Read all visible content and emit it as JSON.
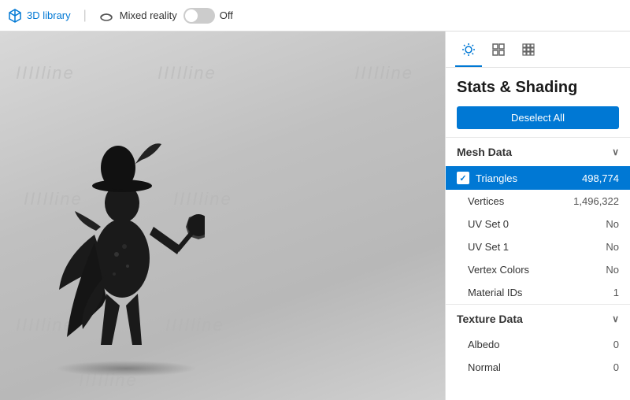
{
  "topbar": {
    "library_label": "3D library",
    "mixed_reality_label": "Mixed reality",
    "toggle_state": "Off"
  },
  "viewport": {
    "watermarks": [
      "IIIIline",
      "IIIIline",
      "IIIIline",
      "IIIIline",
      "IIIIline",
      "IIIIline",
      "IIIIline",
      "IIIIline"
    ]
  },
  "panel": {
    "title": "Stats & Shading",
    "deselect_btn": "Deselect All",
    "tabs": [
      {
        "id": "sun",
        "label": "Sun tab",
        "active": true
      },
      {
        "id": "grid",
        "label": "Grid tab",
        "active": false
      },
      {
        "id": "tiles",
        "label": "Tiles tab",
        "active": false
      }
    ],
    "sections": [
      {
        "id": "mesh-data",
        "label": "Mesh Data",
        "rows": [
          {
            "label": "Triangles",
            "value": "498,774",
            "highlighted": true,
            "checkbox": true,
            "indented": false
          },
          {
            "label": "Vertices",
            "value": "1,496,322",
            "highlighted": false,
            "checkbox": false,
            "indented": true
          },
          {
            "label": "UV Set 0",
            "value": "No",
            "highlighted": false,
            "checkbox": false,
            "indented": true
          },
          {
            "label": "UV Set 1",
            "value": "No",
            "highlighted": false,
            "checkbox": false,
            "indented": true
          },
          {
            "label": "Vertex Colors",
            "value": "No",
            "highlighted": false,
            "checkbox": false,
            "indented": true
          },
          {
            "label": "Material IDs",
            "value": "1",
            "highlighted": false,
            "checkbox": false,
            "indented": true
          }
        ]
      },
      {
        "id": "texture-data",
        "label": "Texture Data",
        "rows": [
          {
            "label": "Albedo",
            "value": "0",
            "highlighted": false,
            "checkbox": false,
            "indented": true
          },
          {
            "label": "Normal",
            "value": "0",
            "highlighted": false,
            "checkbox": false,
            "indented": true
          }
        ]
      }
    ]
  }
}
